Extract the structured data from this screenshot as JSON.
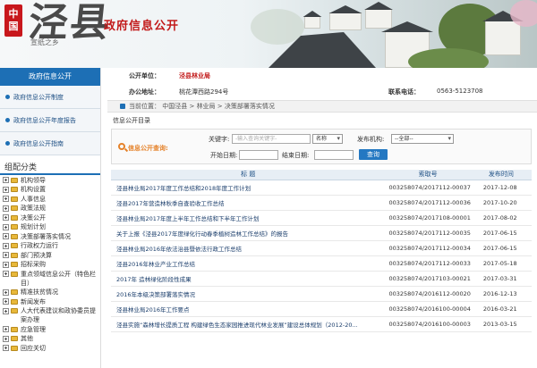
{
  "header": {
    "seal_chars": [
      "中",
      "国"
    ],
    "calligraphy": "泾县",
    "calligraphy_sub": "宣纸之乡",
    "title": "政府信息公开"
  },
  "sidebar": {
    "heading": "政府信息公开",
    "links": [
      {
        "label": "政府信息公开制度",
        "icon": "dot-icon"
      },
      {
        "label": "政府信息公开年度报告",
        "icon": "dot-icon"
      },
      {
        "label": "政府信息公开指南",
        "icon": "dot-icon"
      }
    ],
    "category_title": "组配分类",
    "categories": [
      "机构领导",
      "机构设置",
      "人事信息",
      "政策法规",
      "决策公开",
      "规划计划",
      "决策部署落实情况",
      "行政权力运行",
      "部门预决算",
      "招标采购",
      "重点领域信息公开（特色栏目）",
      "精准扶贫情况",
      "新闻发布",
      "人大代表建议和政协委员提案办理",
      "应急管理",
      "其他",
      "回应关切"
    ]
  },
  "info": {
    "unit_label": "公开单位：",
    "unit_value": "泾县林业局",
    "address_label": "办公地址：",
    "address_value": "桃花潭西路294号",
    "phone_label": "联系电话：",
    "phone_value": "0563-5123708"
  },
  "breadcrumb": {
    "prefix": "当前位置：",
    "items": [
      "中国泾县",
      "林业局",
      "决策部署落实情况"
    ],
    "sep": " > "
  },
  "catalog_label": "信息公开目录",
  "search": {
    "title": "信息公开查询:",
    "keyword_label": "关键字:",
    "keyword_placeholder": "-输入查询关键字-",
    "field_select": "名称",
    "org_label": "发布机构:",
    "org_select": "--全部--",
    "start_label": "开始日期:",
    "end_label": "结束日期:",
    "button": "查询"
  },
  "table": {
    "headers": [
      "标  题",
      "索取号",
      "发布时间"
    ],
    "rows": [
      {
        "title": "泾县林业局2017年度工作总结和2018年度工作计划",
        "no": "003258074/2017112-00037",
        "date": "2017-12-08"
      },
      {
        "title": "泾县2017年营造林秋季自查验收工作总结",
        "no": "003258074/2017112-00036",
        "date": "2017-10-20"
      },
      {
        "title": "泾县林业局2017年度上半年工作总结和下半年工作计划",
        "no": "003258074/2017108-00001",
        "date": "2017-08-02"
      },
      {
        "title": "关于上报《泾县2017年度绿化行动春季植树造林工作总结》的报告",
        "no": "003258074/2017112-00035",
        "date": "2017-06-15"
      },
      {
        "title": "泾县林业局2016年依法治县暨依法行政工作总结",
        "no": "003258074/2017112-00034",
        "date": "2017-06-15"
      },
      {
        "title": "泾县2016年林业产业工作总结",
        "no": "003258074/2017112-00033",
        "date": "2017-05-18"
      },
      {
        "title": "2017年  造林绿化阶段性成果",
        "no": "003258074/2017103-00021",
        "date": "2017-03-31"
      },
      {
        "title": "2016年本级决策部署落实情况",
        "no": "003258074/2016112-00020",
        "date": "2016-12-13"
      },
      {
        "title": "泾县林业局2016年工作要点",
        "no": "003258074/2016100-00004",
        "date": "2016-03-21"
      },
      {
        "title": "泾县实施“森林增长提质工程  构建绿色生态家园推进现代林业发展”建设总体规划（2012-20...",
        "no": "003258074/2016100-00003",
        "date": "2013-03-15"
      }
    ]
  }
}
